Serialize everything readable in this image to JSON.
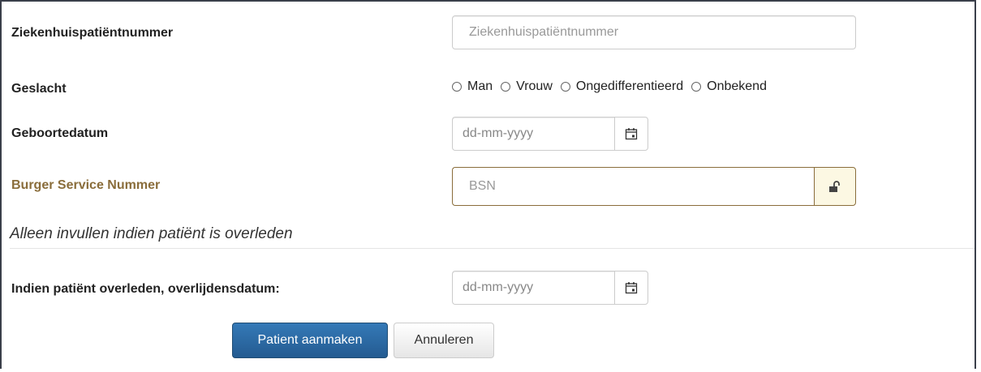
{
  "fields": {
    "hospital_number": {
      "label": "Ziekenhuispatiëntnummer",
      "placeholder": "Ziekenhuispatiëntnummer"
    },
    "gender": {
      "label": "Geslacht",
      "options": [
        "Man",
        "Vrouw",
        "Ongedifferentieerd",
        "Onbekend"
      ]
    },
    "birth_date": {
      "label": "Geboortedatum",
      "placeholder": "dd-mm-yyyy"
    },
    "bsn": {
      "label": "Burger Service Nummer",
      "placeholder": "BSN"
    },
    "deceased_note": "Alleen invullen indien patiënt is overleden",
    "death_date": {
      "label": "Indien patiënt overleden, overlijdensdatum:",
      "placeholder": "dd-mm-yyyy"
    }
  },
  "buttons": {
    "create": "Patient aanmaken",
    "cancel": "Annuleren"
  },
  "icons": {
    "calendar": "calendar-icon",
    "lock": "unlock-icon"
  },
  "colors": {
    "primary": "#2d6ca8",
    "warning_text": "#8a6d3b",
    "warning_bg": "#fcf8e3"
  }
}
